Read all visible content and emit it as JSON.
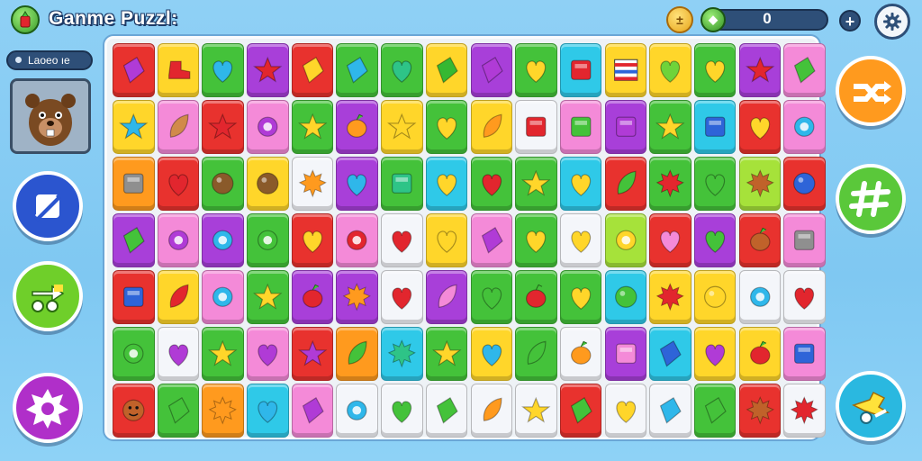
{
  "header": {
    "title": "Ganme Puzzl:",
    "coin_symbol": "±",
    "score": "0",
    "plus_symbol": "+"
  },
  "level": {
    "label": "Laoeo ıe"
  },
  "colors": {
    "red": "#e8322e",
    "yellow": "#ffd62a",
    "green": "#44c23a",
    "purple": "#a83fd9",
    "cyan": "#2fc9e8",
    "pink": "#f48ad8",
    "orange": "#ff9a1e",
    "white": "#f4f6fa",
    "blue": "#2e64d8",
    "lime": "#a6e23a"
  },
  "side_buttons": {
    "left": [
      {
        "name": "pencil-icon",
        "color": "#2b55cf"
      },
      {
        "name": "swap-icon",
        "color": "#6fcf2a"
      },
      {
        "name": "gear-burst-icon",
        "color": "#b02fc9"
      }
    ],
    "right": [
      {
        "name": "shuffle-icon",
        "color": "#ff9a1e"
      },
      {
        "name": "hash-icon",
        "color": "#5ac83a"
      },
      {
        "name": "hint-icon",
        "color": "#2ab8e0"
      }
    ]
  },
  "board": {
    "rows": [
      [
        [
          "red",
          "gem",
          "#b03bd6"
        ],
        [
          "yellow",
          "boot",
          "#e2262e"
        ],
        [
          "green",
          "heart",
          "#2fb7ea"
        ],
        [
          "purple",
          "star",
          "#e2262e"
        ],
        [
          "red",
          "gem",
          "#ffd62a"
        ],
        [
          "green",
          "gem",
          "#2fb7ea"
        ],
        [
          "green",
          "heart",
          "#2ec487"
        ],
        [
          "yellow",
          "gem",
          "#36b832"
        ],
        [
          "purple",
          "gem",
          "#b03bd6"
        ],
        [
          "green",
          "heart",
          "#ffd62a"
        ],
        [
          "cyan",
          "box",
          "#e2262e"
        ],
        [
          "yellow",
          "flag",
          "#e2262e"
        ],
        [
          "yellow",
          "heart",
          "#6fd33a"
        ],
        [
          "green",
          "heart",
          "#ffd62a"
        ],
        [
          "purple",
          "star",
          "#e2262e"
        ],
        [
          "pink",
          "gem",
          "#44c23a"
        ]
      ],
      [
        [
          "yellow",
          "star",
          "#2fb7ea"
        ],
        [
          "pink",
          "leaf",
          "#d18a4a"
        ],
        [
          "red",
          "star",
          "#e2262e"
        ],
        [
          "pink",
          "ring",
          "#b03bd6"
        ],
        [
          "green",
          "star",
          "#ffd62a"
        ],
        [
          "purple",
          "fruit",
          "#ff9a1e"
        ],
        [
          "yellow",
          "star",
          "#ffd62a"
        ],
        [
          "green",
          "heart",
          "#ffd62a"
        ],
        [
          "yellow",
          "leaf",
          "#ff9a1e"
        ],
        [
          "white",
          "box",
          "#e2262e"
        ],
        [
          "pink",
          "box",
          "#44c23a"
        ],
        [
          "purple",
          "box",
          "#b03bd6"
        ],
        [
          "green",
          "star",
          "#ffd62a"
        ],
        [
          "cyan",
          "box",
          "#2e64d8"
        ],
        [
          "red",
          "heart",
          "#ffd62a"
        ],
        [
          "pink",
          "ring",
          "#2fb7ea"
        ]
      ],
      [
        [
          "orange",
          "box",
          "#8f8f8f"
        ],
        [
          "red",
          "heart",
          "#e2262e"
        ],
        [
          "green",
          "ball",
          "#8a5a2a"
        ],
        [
          "yellow",
          "ball",
          "#8a5a2a"
        ],
        [
          "white",
          "burst",
          "#ff9a1e"
        ],
        [
          "purple",
          "heart",
          "#2fb7ea"
        ],
        [
          "green",
          "box",
          "#2ec487"
        ],
        [
          "cyan",
          "heart",
          "#ffd62a"
        ],
        [
          "green",
          "heart",
          "#e2262e"
        ],
        [
          "green",
          "star",
          "#ffd62a"
        ],
        [
          "cyan",
          "heart",
          "#ffd62a"
        ],
        [
          "red",
          "leaf",
          "#44c23a"
        ],
        [
          "green",
          "burst",
          "#e2262e"
        ],
        [
          "green",
          "heart",
          "#44c23a"
        ],
        [
          "lime",
          "burst",
          "#c0622a"
        ],
        [
          "red",
          "ball",
          "#2e64d8"
        ]
      ],
      [
        [
          "purple",
          "gem",
          "#44c23a"
        ],
        [
          "pink",
          "ring",
          "#b03bd6"
        ],
        [
          "purple",
          "ring",
          "#2fb7ea"
        ],
        [
          "green",
          "ring",
          "#44c23a"
        ],
        [
          "red",
          "heart",
          "#ffd62a"
        ],
        [
          "pink",
          "ring",
          "#e2262e"
        ],
        [
          "white",
          "heart",
          "#e2262e"
        ],
        [
          "yellow",
          "heart",
          "#ffd62a"
        ],
        [
          "pink",
          "gem",
          "#b03bd6"
        ],
        [
          "green",
          "heart",
          "#ffd62a"
        ],
        [
          "white",
          "heart",
          "#ffd62a"
        ],
        [
          "lime",
          "ring",
          "#ffd62a"
        ],
        [
          "red",
          "heart",
          "#f48ad8"
        ],
        [
          "purple",
          "heart",
          "#44c23a"
        ],
        [
          "red",
          "fruit",
          "#c0622a"
        ],
        [
          "pink",
          "box",
          "#8f8f8f"
        ]
      ],
      [
        [
          "red",
          "box",
          "#2e64d8"
        ],
        [
          "yellow",
          "leaf",
          "#e2262e"
        ],
        [
          "pink",
          "ring",
          "#2fb7ea"
        ],
        [
          "green",
          "star",
          "#ffd62a"
        ],
        [
          "purple",
          "fruit",
          "#e2262e"
        ],
        [
          "purple",
          "burst",
          "#ff9a1e"
        ],
        [
          "white",
          "heart",
          "#e2262e"
        ],
        [
          "purple",
          "leaf",
          "#f48ad8"
        ],
        [
          "green",
          "heart",
          "#44c23a"
        ],
        [
          "green",
          "fruit",
          "#e2262e"
        ],
        [
          "green",
          "heart",
          "#ffd62a"
        ],
        [
          "cyan",
          "ball",
          "#44c23a"
        ],
        [
          "yellow",
          "burst",
          "#e2262e"
        ],
        [
          "yellow",
          "ball",
          "#ffd62a"
        ],
        [
          "white",
          "ring",
          "#2fb7ea"
        ],
        [
          "white",
          "heart",
          "#e2262e"
        ]
      ],
      [
        [
          "green",
          "ring",
          "#44c23a"
        ],
        [
          "white",
          "heart",
          "#b03bd6"
        ],
        [
          "green",
          "star",
          "#ffd62a"
        ],
        [
          "pink",
          "heart",
          "#b03bd6"
        ],
        [
          "red",
          "star",
          "#b03bd6"
        ],
        [
          "orange",
          "leaf",
          "#44c23a"
        ],
        [
          "cyan",
          "burst",
          "#2ec487"
        ],
        [
          "green",
          "star",
          "#ffd62a"
        ],
        [
          "yellow",
          "heart",
          "#2fb7ea"
        ],
        [
          "green",
          "leaf",
          "#44c23a"
        ],
        [
          "white",
          "fruit",
          "#ff9a1e"
        ],
        [
          "purple",
          "box",
          "#f48ad8"
        ],
        [
          "cyan",
          "gem",
          "#2e64d8"
        ],
        [
          "yellow",
          "heart",
          "#b03bd6"
        ],
        [
          "yellow",
          "fruit",
          "#e2262e"
        ],
        [
          "pink",
          "box",
          "#2e64d8"
        ]
      ],
      [
        [
          "red",
          "face",
          "#c0622a"
        ],
        [
          "green",
          "gem",
          "#44c23a"
        ],
        [
          "orange",
          "burst",
          "#ff9a1e"
        ],
        [
          "cyan",
          "heart",
          "#2fb7ea"
        ],
        [
          "pink",
          "gem",
          "#b03bd6"
        ],
        [
          "white",
          "ring",
          "#2fb7ea"
        ],
        [
          "white",
          "heart",
          "#44c23a"
        ],
        [
          "white",
          "gem",
          "#44c23a"
        ],
        [
          "white",
          "leaf",
          "#ff9a1e"
        ],
        [
          "white",
          "star",
          "#ffd62a"
        ],
        [
          "red",
          "gem",
          "#44c23a"
        ],
        [
          "white",
          "heart",
          "#ffd62a"
        ],
        [
          "white",
          "gem",
          "#2fb7ea"
        ],
        [
          "green",
          "gem",
          "#44c23a"
        ],
        [
          "red",
          "burst",
          "#c0622a"
        ],
        [
          "white",
          "burst",
          "#e2262e"
        ]
      ]
    ]
  }
}
